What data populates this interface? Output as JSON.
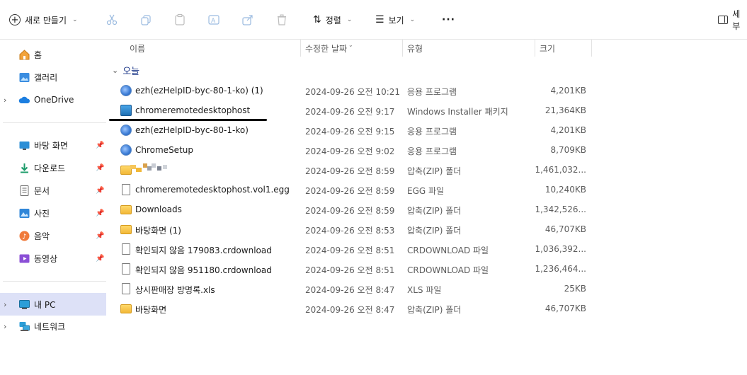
{
  "toolbar": {
    "new_label": "새로 만들기",
    "sort_label": "정렬",
    "view_label": "보기",
    "more_label": "···",
    "details_label": "세부"
  },
  "sidebar": {
    "items": [
      {
        "label": "홈",
        "icon": "home-icon"
      },
      {
        "label": "갤러리",
        "icon": "gallery-icon"
      },
      {
        "label": "OneDrive",
        "icon": "cloud-icon"
      },
      {
        "label": "바탕 화면",
        "icon": "desktop-icon"
      },
      {
        "label": "다운로드",
        "icon": "download-icon"
      },
      {
        "label": "문서",
        "icon": "document-icon"
      },
      {
        "label": "사진",
        "icon": "pictures-icon"
      },
      {
        "label": "음악",
        "icon": "music-icon"
      },
      {
        "label": "동영상",
        "icon": "video-icon"
      },
      {
        "label": "내 PC",
        "icon": "pc-icon"
      },
      {
        "label": "네트워크",
        "icon": "network-icon"
      }
    ]
  },
  "columns": {
    "name": "이름",
    "date": "수정한 날짜",
    "type": "유형",
    "size": "크기"
  },
  "group": {
    "label": "오늘"
  },
  "files": [
    {
      "name": "ezh(ezHelpID-byc-80-1-ko) (1)",
      "date": "2024-09-26 오전 10:21",
      "type": "응용 프로그램",
      "size": "4,201KB",
      "icon": "exe"
    },
    {
      "name": "chromeremotedesktophost",
      "date": "2024-09-26 오전 9:17",
      "type": "Windows Installer 패키지",
      "size": "21,364KB",
      "icon": "msi"
    },
    {
      "name": "ezh(ezHelpID-byc-80-1-ko)",
      "date": "2024-09-26 오전 9:15",
      "type": "응용 프로그램",
      "size": "4,201KB",
      "icon": "exe"
    },
    {
      "name": "ChromeSetup",
      "date": "2024-09-26 오전 9:02",
      "type": "응용 프로그램",
      "size": "8,709KB",
      "icon": "exe"
    },
    {
      "name": "",
      "date": "2024-09-26 오전 8:59",
      "type": "압축(ZIP) 폴더",
      "size": "1,461,032...",
      "icon": "pixelated"
    },
    {
      "name": "chromeremotedesktophost.vol1.egg",
      "date": "2024-09-26 오전 8:59",
      "type": "EGG 파일",
      "size": "10,240KB",
      "icon": "doc"
    },
    {
      "name": "Downloads",
      "date": "2024-09-26 오전 8:59",
      "type": "압축(ZIP) 폴더",
      "size": "1,342,526...",
      "icon": "zip"
    },
    {
      "name": "바탕화면 (1)",
      "date": "2024-09-26 오전 8:53",
      "type": "압축(ZIP) 폴더",
      "size": "46,707KB",
      "icon": "zip"
    },
    {
      "name": "확인되지 않음 179083.crdownload",
      "date": "2024-09-26 오전 8:51",
      "type": "CRDOWNLOAD 파일",
      "size": "1,036,392...",
      "icon": "doc"
    },
    {
      "name": "확인되지 않음 951180.crdownload",
      "date": "2024-09-26 오전 8:51",
      "type": "CRDOWNLOAD 파일",
      "size": "1,236,464...",
      "icon": "doc"
    },
    {
      "name": "상시판매장 방명록.xls",
      "date": "2024-09-26 오전 8:47",
      "type": "XLS 파일",
      "size": "25KB",
      "icon": "doc"
    },
    {
      "name": "바탕화면",
      "date": "2024-09-26 오전 8:47",
      "type": "압축(ZIP) 폴더",
      "size": "46,707KB",
      "icon": "zip"
    }
  ],
  "colors": {
    "accent": "#1f3a8a",
    "selected_bg": "#dde1f7"
  }
}
